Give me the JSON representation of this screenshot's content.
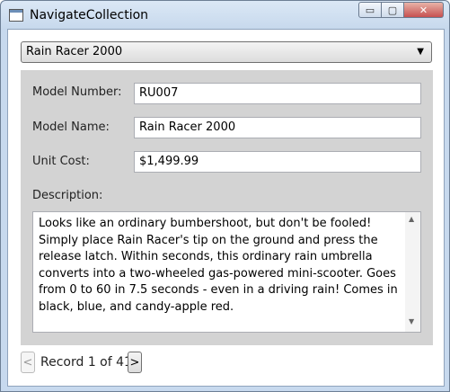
{
  "window": {
    "title": "NavigateCollection",
    "min_label": "▭",
    "max_label": "▢",
    "close_label": "✕"
  },
  "combo": {
    "selected": "Rain Racer 2000"
  },
  "form": {
    "model_number_label": "Model Number:",
    "model_number_value": "RU007",
    "model_name_label": "Model Name:",
    "model_name_value": "Rain Racer 2000",
    "unit_cost_label": "Unit Cost:",
    "unit_cost_value": "$1,499.99",
    "description_label": "Description:",
    "description_value": "Looks like an ordinary bumbershoot, but don't be fooled! Simply place Rain Racer's tip on the ground and press the release latch. Within seconds, this ordinary rain umbrella converts into a two-wheeled gas-powered mini-scooter. Goes from 0 to 60 in 7.5 seconds - even in a driving rain! Comes in black, blue, and candy-apple red."
  },
  "nav": {
    "prev_label": "<",
    "next_label": ">",
    "record_text": "Record 1 of 41"
  }
}
